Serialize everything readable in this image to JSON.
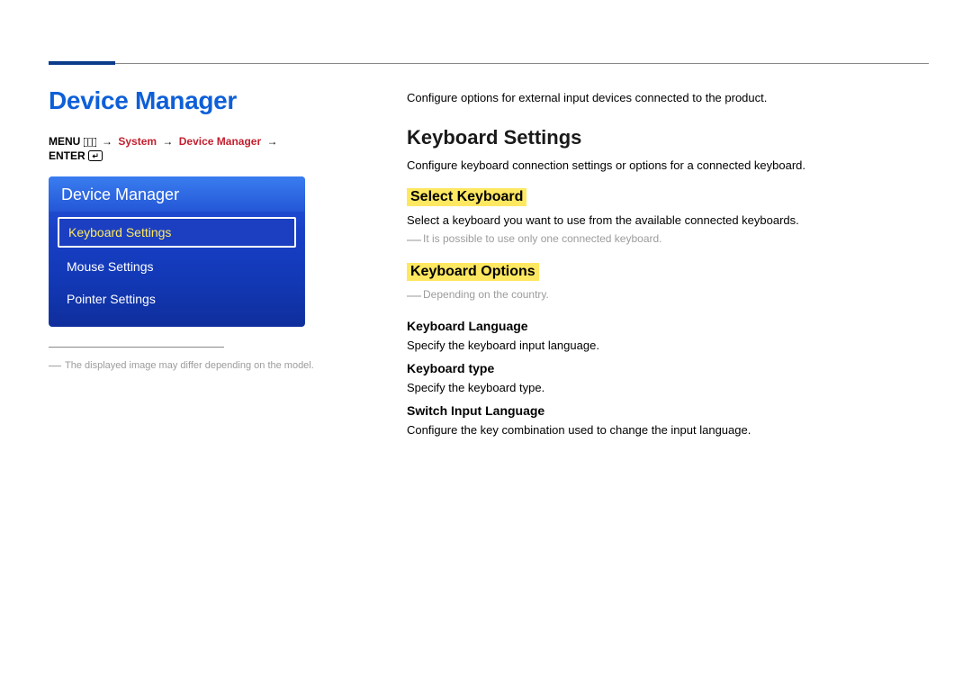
{
  "page_title": "Device Manager",
  "nav_path": {
    "menu_label": "MENU",
    "arrow": "→",
    "seg1": "System",
    "seg2": "Device Manager",
    "enter_label": "ENTER"
  },
  "osd": {
    "header": "Device Manager",
    "items": [
      {
        "label": "Keyboard Settings",
        "selected": true
      },
      {
        "label": "Mouse Settings",
        "selected": false
      },
      {
        "label": "Pointer Settings",
        "selected": false
      }
    ]
  },
  "left_footnote": {
    "dash": "―",
    "text": "The displayed image may differ depending on the model."
  },
  "intro": "Configure options for external input devices connected to the product.",
  "section": {
    "h2": "Keyboard Settings",
    "desc": "Configure keyboard connection settings or options for a connected keyboard.",
    "groups": [
      {
        "h3": "Select Keyboard",
        "desc": "Select a keyboard you want to use from the available connected keyboards.",
        "note": {
          "dash": "―",
          "text": "It is possible to use only one connected keyboard."
        }
      },
      {
        "h3": "Keyboard Options",
        "note": {
          "dash": "―",
          "text": "Depending on the country."
        },
        "subs": [
          {
            "h4": "Keyboard Language",
            "desc": "Specify the keyboard input language."
          },
          {
            "h4": "Keyboard type",
            "desc": "Specify the keyboard type."
          },
          {
            "h4": "Switch Input Language",
            "desc": "Configure the key combination used to change the input language."
          }
        ]
      }
    ]
  }
}
